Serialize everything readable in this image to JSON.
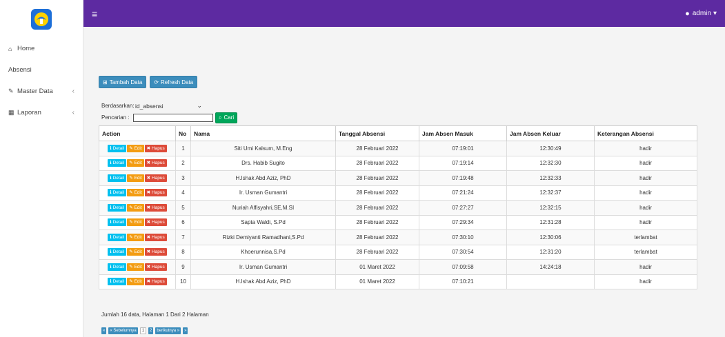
{
  "nav": {
    "logo_icon": "tut-wuri-handayani-logo",
    "items": [
      {
        "label": "Home",
        "icon": "home-icon",
        "has_chevron": false
      },
      {
        "label": "Absensi",
        "icon": "",
        "has_chevron": false
      },
      {
        "label": "Master Data",
        "icon": "edit-icon",
        "has_chevron": true
      },
      {
        "label": "Laporan",
        "icon": "calendar-icon",
        "has_chevron": true
      }
    ]
  },
  "topbar": {
    "menu_icon": "hamburger-icon",
    "user_label": "admin",
    "user_icon": "user-icon",
    "accent": "#5d2aa1"
  },
  "toolbar": {
    "add_label": "Tambah Data",
    "refresh_label": "Refresh Data"
  },
  "filter": {
    "by_label": "Berdasarkan:",
    "by_value": "id_absensi",
    "search_label": "Pencarian :",
    "search_value": "",
    "search_button": "Cari"
  },
  "table": {
    "headers": [
      "Action",
      "No",
      "Nama",
      "Tanggal Absensi",
      "Jam Absen Masuk",
      "Jam Absen Keluar",
      "Keterangan Absensi"
    ],
    "action_labels": {
      "detail": "Detail",
      "edit": "Edit",
      "hapus": "Hapus"
    },
    "rows": [
      {
        "no": "1",
        "nama": "Siti Umi Kalsum, M.Eng",
        "tanggal": "28 Februari 2022",
        "masuk": "07:19:01",
        "keluar": "12:30:49",
        "ket": "hadir"
      },
      {
        "no": "2",
        "nama": "Drs. Habib Sugito",
        "tanggal": "28 Februari 2022",
        "masuk": "07:19:14",
        "keluar": "12:32:30",
        "ket": "hadir"
      },
      {
        "no": "3",
        "nama": "H.Ishak Abd Aziz, PhD",
        "tanggal": "28 Februari 2022",
        "masuk": "07:19:48",
        "keluar": "12:32:33",
        "ket": "hadir"
      },
      {
        "no": "4",
        "nama": "Ir. Usman Gumantri",
        "tanggal": "28 Februari 2022",
        "masuk": "07:21:24",
        "keluar": "12:32:37",
        "ket": "hadir"
      },
      {
        "no": "5",
        "nama": "Nuriah Alfisyahri,SE,M.SI",
        "tanggal": "28 Februari 2022",
        "masuk": "07:27:27",
        "keluar": "12:32:15",
        "ket": "hadir"
      },
      {
        "no": "6",
        "nama": "Sapta Waldi, S.Pd",
        "tanggal": "28 Februari 2022",
        "masuk": "07:29:34",
        "keluar": "12:31:28",
        "ket": "hadir"
      },
      {
        "no": "7",
        "nama": "Rizki Demiyanti Ramadhani,S.Pd",
        "tanggal": "28 Februari 2022",
        "masuk": "07:30:10",
        "keluar": "12:30:06",
        "ket": "terlambat"
      },
      {
        "no": "8",
        "nama": "Khoerunnisa,S.Pd",
        "tanggal": "28 Februari 2022",
        "masuk": "07:30:54",
        "keluar": "12:31:20",
        "ket": "terlambat"
      },
      {
        "no": "9",
        "nama": "Ir. Usman Gumantri",
        "tanggal": "01 Maret 2022",
        "masuk": "07:09:58",
        "keluar": "14:24:18",
        "ket": "hadir"
      },
      {
        "no": "10",
        "nama": "H.Ishak Abd Aziz, PhD",
        "tanggal": "01 Maret 2022",
        "masuk": "07:10:21",
        "keluar": "",
        "ket": "hadir"
      }
    ]
  },
  "summary": "Jumlah 16 data, Halaman 1 Dari 2 Halaman",
  "pager": {
    "first": "«",
    "prev": "« Sebelumnya",
    "pages": [
      "1",
      "2"
    ],
    "current": "2",
    "next": "berikutnya »",
    "last": "»"
  }
}
